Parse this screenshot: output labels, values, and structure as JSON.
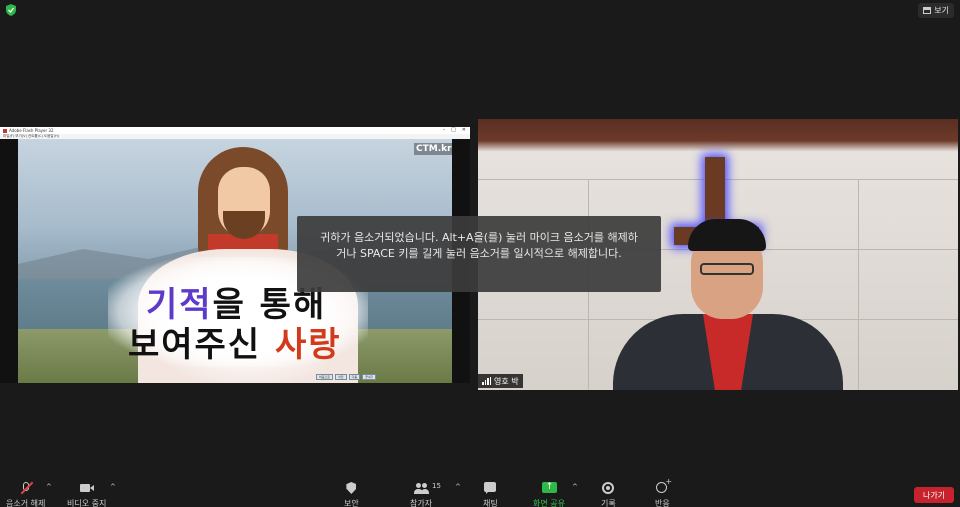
{
  "top_bar": {
    "view_label": "보기"
  },
  "shared_screen": {
    "window_title": "Adobe Flash Player 32",
    "window_controls": [
      "–",
      "□",
      "✕"
    ],
    "menu": "파일(F)  보기(V)  컨트롤(C)  도움말(H)",
    "logo": "CTM.kr",
    "slide_line1_highlight": "기적",
    "slide_line1_rest": "을 통해",
    "slide_line2_rest": "보여주신 ",
    "slide_line2_highlight": "사랑",
    "slide_buttons": [
      "처음으로",
      "이전",
      "다음",
      "끝내기"
    ],
    "highlight_color_1": "#5e3acb",
    "highlight_color_2": "#d23a1a"
  },
  "participant": {
    "name": "영호 박"
  },
  "toast": {
    "message": "귀하가 음소거되었습니다. Alt+A을(를) 눌러 마이크 음소거를 해제하거나 SPACE 키를 길게 눌러 음소거를 일시적으로 해제합니다."
  },
  "toolbar": {
    "unmute_label": "음소거 해제",
    "video_label": "비디오 중지",
    "security_label": "보안",
    "participants_label": "참가자",
    "participants_count": "15",
    "chat_label": "채팅",
    "share_label": "화면 공유",
    "record_label": "기록",
    "reactions_label": "반응",
    "leave_label": "나가기",
    "caret": "^",
    "share_color": "#2eb84a",
    "leave_color": "#c6232c"
  },
  "icons": [
    "shield-check-icon",
    "grid-view-icon",
    "mic-muted-icon",
    "video-camera-icon",
    "security-shield-icon",
    "participants-icon",
    "chat-bubble-icon",
    "share-screen-icon",
    "record-icon",
    "reactions-icon",
    "signal-icon"
  ]
}
